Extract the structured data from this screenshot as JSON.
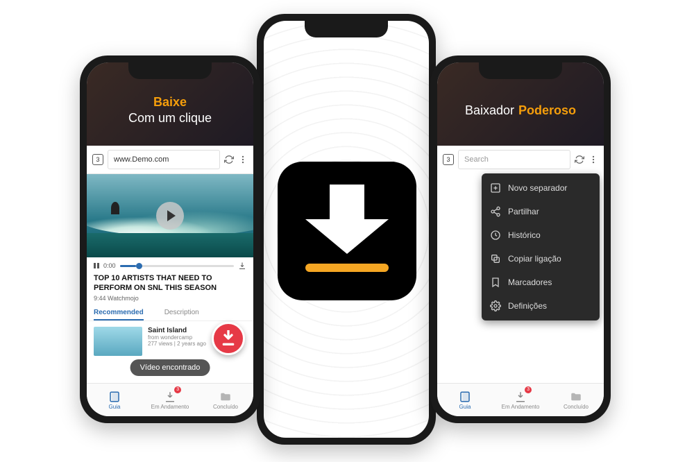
{
  "left": {
    "hero_line1": "Baixe",
    "hero_line2": "Com um clique",
    "tab_count": "3",
    "url": "www.Demo.com",
    "progress_time": "0:00",
    "video_title": "TOP 10 ARTISTS THAT NEED TO PERFORM ON SNL THIS SEASON",
    "video_duration": "9:44",
    "video_channel": "Watchmojo",
    "tabs": {
      "recommended": "Recommended",
      "description": "Description"
    },
    "rec": {
      "title": "Saint Island",
      "by": "from wondercamp",
      "meta": "277 views | 2 years ago"
    },
    "toast": "Vídeo encontrado"
  },
  "right": {
    "hero_a": "Baixador",
    "hero_b": "Poderoso",
    "tab_count": "3",
    "search_placeholder": "Search",
    "menu": {
      "novo": "Novo separador",
      "partilhar": "Partilhar",
      "historico": "Histórico",
      "copiar": "Copiar ligação",
      "marcadores": "Marcadores",
      "definicoes": "Definições"
    }
  },
  "nav": {
    "guia": "Guia",
    "em_andamento": "Em Andamento",
    "concluido": "Concluído",
    "badge": "3"
  }
}
